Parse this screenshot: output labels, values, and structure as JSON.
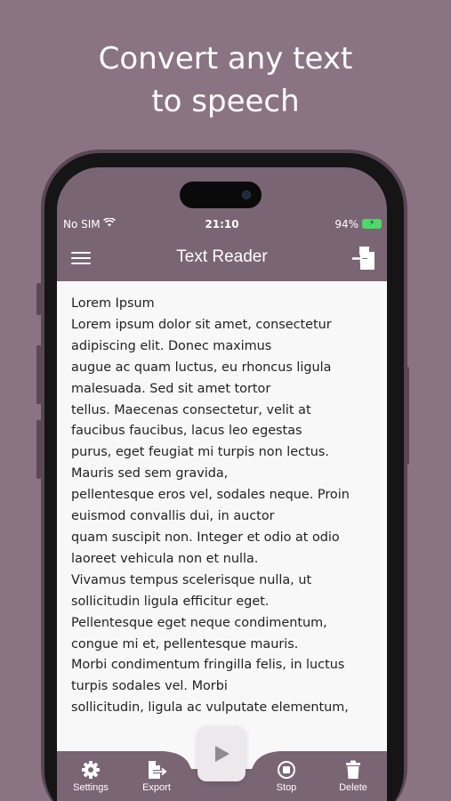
{
  "promo": {
    "line1": "Convert any text",
    "line2": "to speech"
  },
  "status": {
    "carrier": "No SIM",
    "time": "21:10",
    "battery_pct": "94%",
    "battery_icon": "⚡"
  },
  "appbar": {
    "title": "Text Reader"
  },
  "content": {
    "lines": [
      "Lorem Ipsum",
      "Lorem ipsum dolor sit amet, consectetur",
      "adipiscing elit. Donec maximus",
      "augue ac quam luctus, eu rhoncus ligula",
      "malesuada. Sed sit amet tortor",
      "tellus. Maecenas consectetur, velit at",
      "faucibus faucibus, lacus leo egestas",
      "purus, eget feugiat mi turpis non lectus.",
      "Mauris sed sem gravida,",
      "pellentesque eros vel, sodales neque. Proin",
      "euismod convallis dui, in auctor",
      "quam suscipit non. Integer et odio at odio",
      "laoreet vehicula non et nulla.",
      "Vivamus tempus scelerisque nulla, ut",
      "sollicitudin ligula efficitur eget.",
      "Pellentesque eget neque condimentum,",
      "congue mi et, pellentesque mauris.",
      "Morbi condimentum fringilla felis, in luctus",
      "turpis sodales vel. Morbi",
      "sollicitudin, ligula ac vulputate elementum,"
    ]
  },
  "bottom_nav": {
    "settings": "Settings",
    "export": "Export",
    "stop": "Stop",
    "delete": "Delete"
  },
  "colors": {
    "background": "#8a7484",
    "bar": "#7a6575",
    "content": "#f8f8f8"
  }
}
